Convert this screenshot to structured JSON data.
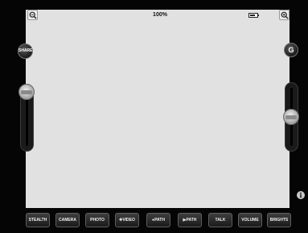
{
  "top_bar": {
    "zoom_level": "100%",
    "zoom_out_icon": "zoom-out-magnifier-icon",
    "zoom_in_icon": "zoom-in-magnifier-icon",
    "battery_level": 0.7
  },
  "side_controls": {
    "share_label": "SHARE",
    "g_label": "G",
    "left_slider_level": 1.0,
    "right_slider_level": 0.5
  },
  "info_icon": "i",
  "toolbar": {
    "buttons": [
      {
        "label": "STEALTH"
      },
      {
        "label": "CAMERA"
      },
      {
        "label": "PHOTO"
      },
      {
        "label": "✚VIDEO"
      },
      {
        "label": "●PATH"
      },
      {
        "label": "▶PATH"
      },
      {
        "label": "TALK"
      },
      {
        "label": "VOLUME"
      },
      {
        "label": "BRIGHTS"
      }
    ]
  },
  "colors": {
    "background": "#050505",
    "screen": "#e1e1e1",
    "button": "#2a2a2a",
    "button_text": "#f2f2f2"
  }
}
